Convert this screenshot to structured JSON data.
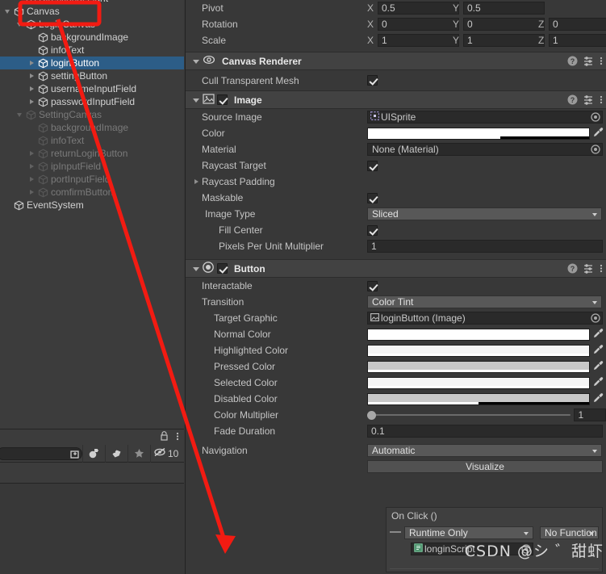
{
  "hierarchy": {
    "items": [
      {
        "label": "Directional Light",
        "depth": 1,
        "toggle": "none",
        "faded": false,
        "selected": false,
        "clipped": true
      },
      {
        "label": "Canvas",
        "depth": 0,
        "toggle": "down",
        "faded": false,
        "selected": false
      },
      {
        "label": "LoginCanvas",
        "depth": 1,
        "toggle": "down",
        "faded": false,
        "selected": false
      },
      {
        "label": "backgroundImage",
        "depth": 2,
        "toggle": "none",
        "faded": false,
        "selected": false
      },
      {
        "label": "infoText",
        "depth": 2,
        "toggle": "none",
        "faded": false,
        "selected": false
      },
      {
        "label": "loginButton",
        "depth": 2,
        "toggle": "right",
        "faded": false,
        "selected": true
      },
      {
        "label": "settingButton",
        "depth": 2,
        "toggle": "right",
        "faded": false,
        "selected": false
      },
      {
        "label": "usernameInputField",
        "depth": 2,
        "toggle": "right",
        "faded": false,
        "selected": false
      },
      {
        "label": "passwordInputField",
        "depth": 2,
        "toggle": "right",
        "faded": false,
        "selected": false
      },
      {
        "label": "SettingCanvas",
        "depth": 1,
        "toggle": "down",
        "faded": true,
        "selected": false
      },
      {
        "label": "backgroundImage",
        "depth": 2,
        "toggle": "none",
        "faded": true,
        "selected": false
      },
      {
        "label": "infoText",
        "depth": 2,
        "toggle": "none",
        "faded": true,
        "selected": false
      },
      {
        "label": "returnLoginButton",
        "depth": 2,
        "toggle": "right",
        "faded": true,
        "selected": false
      },
      {
        "label": "ipInputField",
        "depth": 2,
        "toggle": "right",
        "faded": true,
        "selected": false
      },
      {
        "label": "portInputField",
        "depth": 2,
        "toggle": "right",
        "faded": true,
        "selected": false
      },
      {
        "label": "comfirmButton",
        "depth": 2,
        "toggle": "right",
        "faded": true,
        "selected": false
      },
      {
        "label": "EventSystem",
        "depth": 0,
        "toggle": "none",
        "faded": false,
        "selected": false
      }
    ]
  },
  "bottom_panel": {
    "search_value": "",
    "lock_icon": "lock-icon",
    "menu_icon": "kebab-menu-icon",
    "expand_icon": "expand-search-icon",
    "buttons": [
      "paint-icon",
      "tag-icon",
      "star-icon"
    ],
    "hidden_count": "10",
    "hidden_icon": "eye-crossed-icon"
  },
  "inspector": {
    "transform_rows": [
      {
        "label": "Pivot",
        "axes": [
          {
            "axis": "X",
            "value": "0.5"
          },
          {
            "axis": "Y",
            "value": "0.5"
          }
        ]
      },
      {
        "label": "Rotation",
        "axes": [
          {
            "axis": "X",
            "value": "0"
          },
          {
            "axis": "Y",
            "value": "0"
          },
          {
            "axis": "Z",
            "value": "0"
          }
        ]
      },
      {
        "label": "Scale",
        "axes": [
          {
            "axis": "X",
            "value": "1"
          },
          {
            "axis": "Y",
            "value": "1"
          },
          {
            "axis": "Z",
            "value": "1"
          }
        ]
      }
    ],
    "canvas_renderer": {
      "title": "Canvas Renderer",
      "icon": "eye-icon",
      "help_icon": "help-icon",
      "preset_icon": "preset-icon",
      "menu_icon": "kebab-menu-icon",
      "cull_label": "Cull Transparent Mesh",
      "cull_checked": true
    },
    "image": {
      "title": "Image",
      "icon": "image-component-icon",
      "enabled": true,
      "help_icon": "help-icon",
      "preset_icon": "preset-icon",
      "menu_icon": "kebab-menu-icon",
      "source_image_label": "Source Image",
      "source_image_value": "UISprite",
      "source_image_icon": "sprite-icon",
      "color_label": "Color",
      "color_value": "#FFFFFF",
      "color_alpha_pct": 60,
      "material_label": "Material",
      "material_value": "None (Material)",
      "raycast_target_label": "Raycast Target",
      "raycast_target_checked": true,
      "raycast_padding_label": "Raycast Padding",
      "maskable_label": "Maskable",
      "maskable_checked": true,
      "image_type_label": "Image Type",
      "image_type_value": "Sliced",
      "fill_center_label": "Fill Center",
      "fill_center_checked": true,
      "pixels_label": "Pixels Per Unit Multiplier",
      "pixels_value": "1"
    },
    "button": {
      "title": "Button",
      "icon": "button-component-icon",
      "enabled": true,
      "help_icon": "help-icon",
      "preset_icon": "preset-icon",
      "menu_icon": "kebab-menu-icon",
      "interactable_label": "Interactable",
      "interactable_checked": true,
      "transition_label": "Transition",
      "transition_value": "Color Tint",
      "target_graphic_label": "Target Graphic",
      "target_graphic_value": "loginButton (Image)",
      "target_graphic_icon": "image-component-icon",
      "colors": [
        {
          "label": "Normal Color",
          "hex": "#FFFFFF",
          "alpha_pct": 100
        },
        {
          "label": "Highlighted Color",
          "hex": "#F5F5F5",
          "alpha_pct": 100
        },
        {
          "label": "Pressed Color",
          "hex": "#C8C8C8",
          "alpha_pct": 100
        },
        {
          "label": "Selected Color",
          "hex": "#F5F5F5",
          "alpha_pct": 100
        },
        {
          "label": "Disabled Color",
          "hex": "#C8C8C8",
          "alpha_pct": 50
        }
      ],
      "color_multiplier_label": "Color Multiplier",
      "color_multiplier_value": "1",
      "color_multiplier_pct": 0,
      "fade_duration_label": "Fade Duration",
      "fade_duration_value": "0.1",
      "navigation_label": "Navigation",
      "navigation_value": "Automatic",
      "visualize_label": "Visualize"
    },
    "on_click": {
      "title": "On Click ()",
      "runtime_mode": "Runtime Only",
      "function_value": "No Function",
      "object_value": "longinScript",
      "object_icon": "script-icon",
      "picker_icon": "object-picker-icon"
    }
  },
  "watermark": "CSDN @シ ゛甜虾",
  "annotation": {
    "highlight_color": "#F21B12",
    "box_label": "canvas-highlight-box",
    "arrow_label": "annotation-arrow"
  }
}
